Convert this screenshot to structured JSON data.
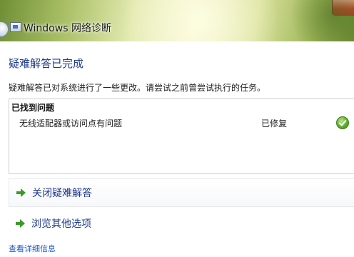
{
  "window": {
    "title": "Windows 网络诊断"
  },
  "main": {
    "heading": "疑难解答已完成",
    "description": "疑难解答已对系统进行了一些更改。请尝试之前曾尝试执行的任务。",
    "problems_header": "已找到问题",
    "problems": [
      {
        "text": "无线适配器或访问点有问题",
        "status": "已修复",
        "status_icon": "check-icon"
      }
    ],
    "actions": [
      {
        "label": "关闭疑难解答",
        "icon": "arrow-right-icon"
      },
      {
        "label": "浏览其他选项",
        "icon": "arrow-right-icon"
      }
    ],
    "details_link": "查看详细信息"
  },
  "colors": {
    "heading": "#1e3a8a",
    "link": "#1a56c9",
    "arrow": "#3a9a2a",
    "check": "#5fae2e"
  }
}
